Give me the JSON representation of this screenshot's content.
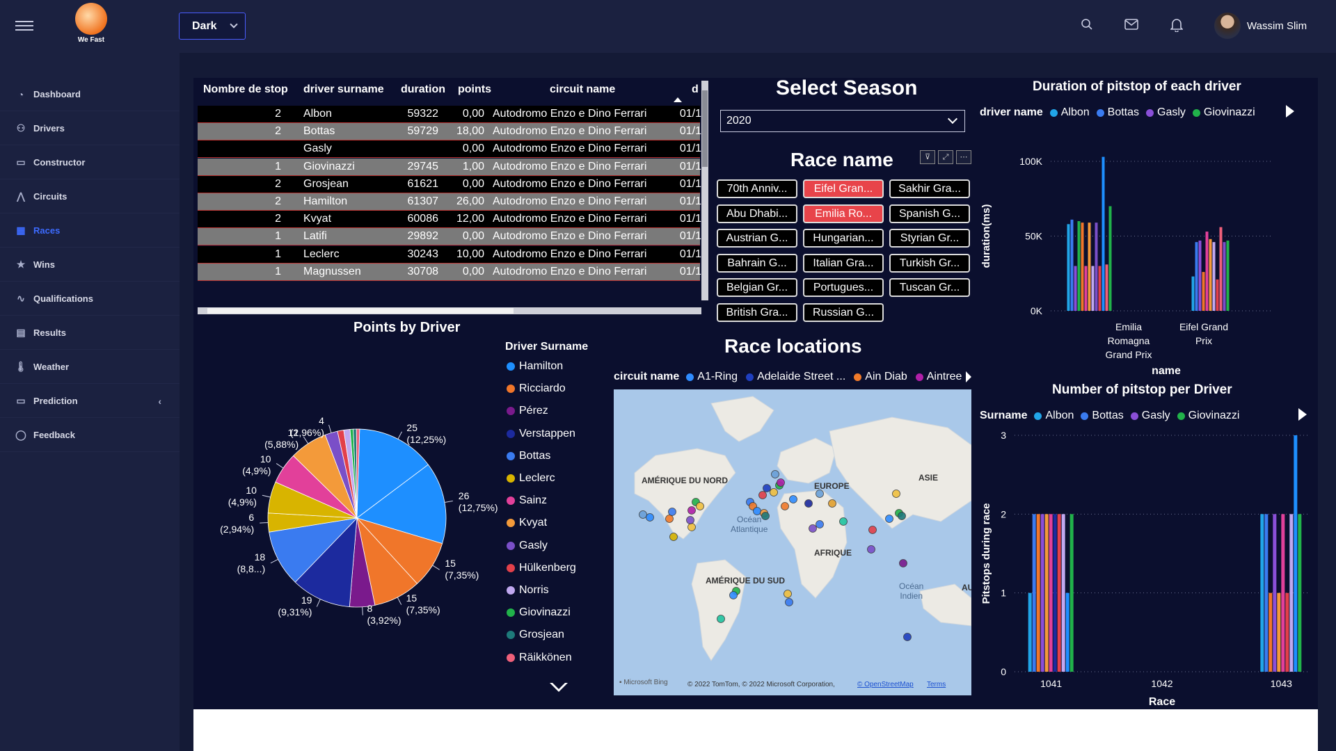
{
  "app": {
    "logo_text": "We Fast",
    "theme": "Dark",
    "user_name": "Wassim Slim"
  },
  "sidebar": {
    "items": [
      {
        "label": "Dashboard",
        "icon": "dashboard-icon"
      },
      {
        "label": "Drivers",
        "icon": "users-icon"
      },
      {
        "label": "Constructor",
        "icon": "monitor-icon"
      },
      {
        "label": "Circuits",
        "icon": "circuit-icon"
      },
      {
        "label": "Races",
        "icon": "grid-icon"
      },
      {
        "label": "Wins",
        "icon": "star-icon"
      },
      {
        "label": "Qualifications",
        "icon": "activity-icon"
      },
      {
        "label": "Results",
        "icon": "table-icon"
      },
      {
        "label": "Weather",
        "icon": "thermometer-icon"
      },
      {
        "label": "Prediction",
        "icon": "monitor-icon"
      },
      {
        "label": "Feedback",
        "icon": "chat-icon"
      }
    ],
    "active": "Races"
  },
  "table": {
    "headers": [
      "Nombre de stop",
      "driver surname",
      "duration",
      "points",
      "circuit name",
      "d"
    ],
    "rows": [
      {
        "stops": "2",
        "surname": "Albon",
        "duration": "59322",
        "points": "0,00",
        "circuit": "Autodromo Enzo e Dino Ferrari",
        "d": "01/1"
      },
      {
        "stops": "2",
        "surname": "Bottas",
        "duration": "59729",
        "points": "18,00",
        "circuit": "Autodromo Enzo e Dino Ferrari",
        "d": "01/1"
      },
      {
        "stops": "",
        "surname": "Gasly",
        "duration": "",
        "points": "0,00",
        "circuit": "Autodromo Enzo e Dino Ferrari",
        "d": "01/1"
      },
      {
        "stops": "1",
        "surname": "Giovinazzi",
        "duration": "29745",
        "points": "1,00",
        "circuit": "Autodromo Enzo e Dino Ferrari",
        "d": "01/1"
      },
      {
        "stops": "2",
        "surname": "Grosjean",
        "duration": "61621",
        "points": "0,00",
        "circuit": "Autodromo Enzo e Dino Ferrari",
        "d": "01/1"
      },
      {
        "stops": "2",
        "surname": "Hamilton",
        "duration": "61307",
        "points": "26,00",
        "circuit": "Autodromo Enzo e Dino Ferrari",
        "d": "01/1"
      },
      {
        "stops": "2",
        "surname": "Kvyat",
        "duration": "60086",
        "points": "12,00",
        "circuit": "Autodromo Enzo e Dino Ferrari",
        "d": "01/1"
      },
      {
        "stops": "1",
        "surname": "Latifi",
        "duration": "29892",
        "points": "0,00",
        "circuit": "Autodromo Enzo e Dino Ferrari",
        "d": "01/1"
      },
      {
        "stops": "1",
        "surname": "Leclerc",
        "duration": "30243",
        "points": "10,00",
        "circuit": "Autodromo Enzo e Dino Ferrari",
        "d": "01/1"
      },
      {
        "stops": "1",
        "surname": "Magnussen",
        "duration": "30708",
        "points": "0,00",
        "circuit": "Autodromo Enzo e Dino Ferrari",
        "d": "01/1"
      }
    ]
  },
  "season": {
    "title": "Select Season",
    "value": "2020"
  },
  "race_slicer": {
    "title": "Race name",
    "buttons": [
      {
        "label": "70th Anniv...",
        "selected": false
      },
      {
        "label": "Eifel Gran...",
        "selected": true
      },
      {
        "label": "Sakhir Gra...",
        "selected": false
      },
      {
        "label": "Abu Dhabi...",
        "selected": false
      },
      {
        "label": "Emilia Ro...",
        "selected": true
      },
      {
        "label": "Spanish G...",
        "selected": false
      },
      {
        "label": "Austrian G...",
        "selected": false
      },
      {
        "label": "Hungarian...",
        "selected": false
      },
      {
        "label": "Styrian Gr...",
        "selected": false
      },
      {
        "label": "Bahrain G...",
        "selected": false
      },
      {
        "label": "Italian Gra...",
        "selected": false
      },
      {
        "label": "Turkish Gr...",
        "selected": false
      },
      {
        "label": "Belgian Gr...",
        "selected": false
      },
      {
        "label": "Portugues...",
        "selected": false
      },
      {
        "label": "Tuscan Gr...",
        "selected": false
      },
      {
        "label": "British Gra...",
        "selected": false
      },
      {
        "label": "Russian G...",
        "selected": false
      }
    ]
  },
  "map": {
    "title": "Race locations",
    "legend_title": "circuit name",
    "legend": [
      {
        "name": "A1-Ring",
        "color": "#2f8cff"
      },
      {
        "name": "Adelaide Street ...",
        "color": "#1f3fbf"
      },
      {
        "name": "Ain Diab",
        "color": "#f07a2a"
      },
      {
        "name": "Aintree",
        "color": "#b01fa8"
      }
    ],
    "labels": {
      "north_america": "AMÉRIQUE DU NORD",
      "europe": "EUROPE",
      "asia": "ASIE",
      "africa": "AFRIQUE",
      "south_america": "AMÉRIQUE DU SUD",
      "atlantic_1": "Océan",
      "atlantic_2": "Atlantique",
      "indian_1": "Océan",
      "indian_2": "Indien",
      "au": "AUS"
    },
    "footer": {
      "brand": "Microsoft Bing",
      "copyright": "© 2022 TomTom, © 2022 Microsoft Corporation,",
      "osm": "© OpenStreetMap",
      "terms": "Terms"
    }
  },
  "charts": {
    "pie_title": "Points by Driver",
    "pie_legend_title": "Driver Surname",
    "duration_title": "Duration of pitstop of each driver",
    "duration_legend_title": "driver name",
    "pitstop_title": "Number of pitstop per Driver",
    "pitstop_legend_title": "Surname",
    "driver_legend": [
      {
        "name": "Albon",
        "color": "#21a5e8"
      },
      {
        "name": "Bottas",
        "color": "#3a7bf0"
      },
      {
        "name": "Gasly",
        "color": "#8a4fd8"
      },
      {
        "name": "Giovinazzi",
        "color": "#21b24a"
      }
    ]
  },
  "chart_data": [
    {
      "type": "pie",
      "title": "Points by Driver",
      "legend_title": "Driver Surname",
      "legend": [
        {
          "name": "Hamilton",
          "color": "#1e8fff"
        },
        {
          "name": "Ricciardo",
          "color": "#f0762a"
        },
        {
          "name": "Pérez",
          "color": "#7a1a8c"
        },
        {
          "name": "Verstappen",
          "color": "#1c2a9e"
        },
        {
          "name": "Bottas",
          "color": "#3a7bf0"
        },
        {
          "name": "Leclerc",
          "color": "#d8b400"
        },
        {
          "name": "Sainz",
          "color": "#e2409a"
        },
        {
          "name": "Kvyat",
          "color": "#f39a3a"
        },
        {
          "name": "Gasly",
          "color": "#7a4fc8"
        },
        {
          "name": "Hülkenberg",
          "color": "#e2404a"
        },
        {
          "name": "Norris",
          "color": "#c0a8f0"
        },
        {
          "name": "Giovinazzi",
          "color": "#21b24a"
        },
        {
          "name": "Grosjean",
          "color": "#1e7a7a"
        },
        {
          "name": "Räikkönen",
          "color": "#f0607a"
        }
      ],
      "slices": [
        {
          "name": "Hamilton",
          "value": 25,
          "label": "25 (12,25%)",
          "color": "#1e8fff"
        },
        {
          "name": "Hamilton",
          "value": 26,
          "label": "26 (12,75%)",
          "color": "#1e8fff"
        },
        {
          "name": "Ricciardo",
          "value": 15,
          "label": "15 (7,35%)",
          "color": "#f0762a"
        },
        {
          "name": "Ricciardo",
          "value": 15,
          "label": "15 (7,35%)",
          "color": "#f0762a"
        },
        {
          "name": "Pérez",
          "value": 8,
          "label": "8 (3,92%)",
          "color": "#7a1a8c"
        },
        {
          "name": "Verstappen",
          "value": 19,
          "label": "19 (9,31%)",
          "color": "#1c2a9e"
        },
        {
          "name": "Bottas",
          "value": 18,
          "label": "18 (8,8...)",
          "color": "#3a7bf0"
        },
        {
          "name": "Leclerc",
          "value": 6,
          "label": "6 (2,94%)",
          "color": "#d8b400"
        },
        {
          "name": "Leclerc",
          "value": 10,
          "label": "10 (4,9%)",
          "color": "#d8b400"
        },
        {
          "name": "Sainz",
          "value": 10,
          "label": "10 (4,9%)",
          "color": "#e2409a"
        },
        {
          "name": "Kvyat",
          "value": 12,
          "label": "12 (5,88%)",
          "color": "#f39a3a"
        },
        {
          "name": "Gasly",
          "value": 4,
          "label": "4 (1,96%)",
          "color": "#7a4fc8"
        },
        {
          "name": "Hülkenberg",
          "value": 2,
          "label": "",
          "color": "#e2404a"
        },
        {
          "name": "Norris",
          "value": 2,
          "label": "",
          "color": "#c0a8f0"
        },
        {
          "name": "Giovinazzi",
          "value": 1,
          "label": "",
          "color": "#21b24a"
        },
        {
          "name": "Grosjean",
          "value": 1,
          "label": "",
          "color": "#1e7a7a"
        },
        {
          "name": "Räikkönen",
          "value": 1,
          "label": "",
          "color": "#f0607a"
        }
      ]
    },
    {
      "type": "bar",
      "title": "Duration of pitstop of each driver",
      "xlabel": "name",
      "ylabel": "duration(ms)",
      "yticks": [
        "0K",
        "50K",
        "100K"
      ],
      "ylim": [
        0,
        100000
      ],
      "categories": [
        "Emilia Romagna Grand Prix",
        "Eifel Grand Prix"
      ],
      "category_lines": [
        [
          "Emilia",
          "Romagna",
          "Grand Prix"
        ],
        [
          "Eifel Grand",
          "Prix"
        ]
      ],
      "groups": [
        [
          {
            "v": 58000,
            "c": "#21a5e8"
          },
          {
            "v": 61000,
            "c": "#3a7bf0"
          },
          {
            "v": 30000,
            "c": "#8a4fd8"
          },
          {
            "v": 60000,
            "c": "#21b24a"
          },
          {
            "v": 59000,
            "c": "#f0762a"
          },
          {
            "v": 30000,
            "c": "#e2409a"
          },
          {
            "v": 59000,
            "c": "#f39a3a"
          },
          {
            "v": 30000,
            "c": "#c0a8f0"
          },
          {
            "v": 59000,
            "c": "#7a4fc8"
          },
          {
            "v": 30000,
            "c": "#e2404a"
          },
          {
            "v": 103000,
            "c": "#1e8fff"
          },
          {
            "v": 31000,
            "c": "#f0607a"
          },
          {
            "v": 70000,
            "c": "#21b24a"
          }
        ],
        [
          {
            "v": 23000,
            "c": "#21a5e8"
          },
          {
            "v": 46000,
            "c": "#3a7bf0"
          },
          {
            "v": 47000,
            "c": "#8a4fd8"
          },
          {
            "v": 26000,
            "c": "#f0762a"
          },
          {
            "v": 53000,
            "c": "#e2409a"
          },
          {
            "v": 48000,
            "c": "#f39a3a"
          },
          {
            "v": 46000,
            "c": "#c0a8f0"
          },
          {
            "v": 21000,
            "c": "#e2404a"
          },
          {
            "v": 56000,
            "c": "#f0607a"
          },
          {
            "v": 46000,
            "c": "#7a4fc8"
          },
          {
            "v": 47000,
            "c": "#21b24a"
          }
        ]
      ]
    },
    {
      "type": "bar",
      "title": "Number of pitstop per Driver",
      "xlabel": "Race",
      "ylabel": "Pitstops during race",
      "yticks": [
        "0",
        "1",
        "2",
        "3"
      ],
      "ylim": [
        0,
        3
      ],
      "categories": [
        "1041",
        "1042",
        "1043"
      ],
      "groups": [
        [
          {
            "v": 1,
            "c": "#21a5e8"
          },
          {
            "v": 2,
            "c": "#3a7bf0"
          },
          {
            "v": 2,
            "c": "#f0762a"
          },
          {
            "v": 2,
            "c": "#8a4fd8"
          },
          {
            "v": 2,
            "c": "#f39a3a"
          },
          {
            "v": 2,
            "c": "#e2409a"
          },
          {
            "v": 2,
            "c": "#1c2a9e"
          },
          {
            "v": 2,
            "c": "#e2404a"
          },
          {
            "v": 2,
            "c": "#c0a8f0"
          },
          {
            "v": 1,
            "c": "#1e8fff"
          },
          {
            "v": 2,
            "c": "#21b24a"
          }
        ],
        [],
        [
          {
            "v": 2,
            "c": "#21a5e8"
          },
          {
            "v": 2,
            "c": "#3a7bf0"
          },
          {
            "v": 1,
            "c": "#f0762a"
          },
          {
            "v": 2,
            "c": "#8a4fd8"
          },
          {
            "v": 1,
            "c": "#f39a3a"
          },
          {
            "v": 2,
            "c": "#e2409a"
          },
          {
            "v": 1,
            "c": "#e2404a"
          },
          {
            "v": 2,
            "c": "#c0a8f0"
          },
          {
            "v": 3,
            "c": "#1e8fff"
          },
          {
            "v": 2,
            "c": "#21b24a"
          }
        ]
      ]
    }
  ]
}
